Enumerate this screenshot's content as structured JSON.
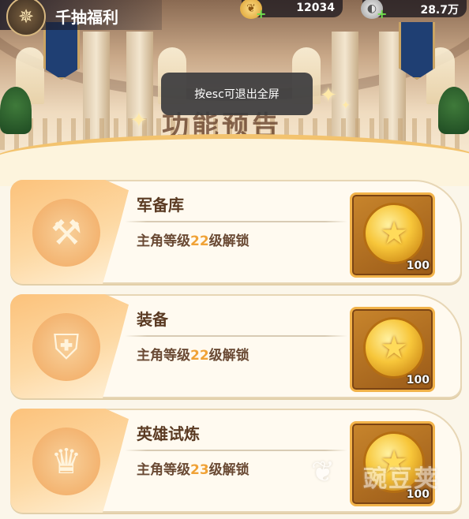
{
  "header": {
    "title": "千抽福利",
    "emblem_icon": "compass-emblem-icon"
  },
  "resources": [
    {
      "icon": "gold-feather-coin-icon",
      "value": "12034"
    },
    {
      "icon": "silver-coin-icon",
      "value": "28.7万"
    }
  ],
  "hero": {
    "title": "功能预告"
  },
  "toast": {
    "text": "按esc可退出全屏"
  },
  "cards": [
    {
      "name": "军备库",
      "req_prefix": "主角等级",
      "level": "22",
      "req_suffix": "级解锁",
      "icon": "war-hammer-icon",
      "reward_icon": "star-coin-icon",
      "reward_qty": "100"
    },
    {
      "name": "装备",
      "req_prefix": "主角等级",
      "level": "22",
      "req_suffix": "级解锁",
      "icon": "armor-icon",
      "reward_icon": "star-coin-icon",
      "reward_qty": "100"
    },
    {
      "name": "英雄试炼",
      "req_prefix": "主角等级",
      "level": "23",
      "req_suffix": "级解锁",
      "icon": "crown-flame-icon",
      "reward_icon": "star-coin-icon",
      "reward_qty": "100"
    }
  ],
  "watermark": {
    "text": "豌豆荚"
  },
  "colors": {
    "accent_orange": "#f0a236",
    "card_bg": "#fffaf0",
    "toast_bg": "#3c3c3e"
  }
}
